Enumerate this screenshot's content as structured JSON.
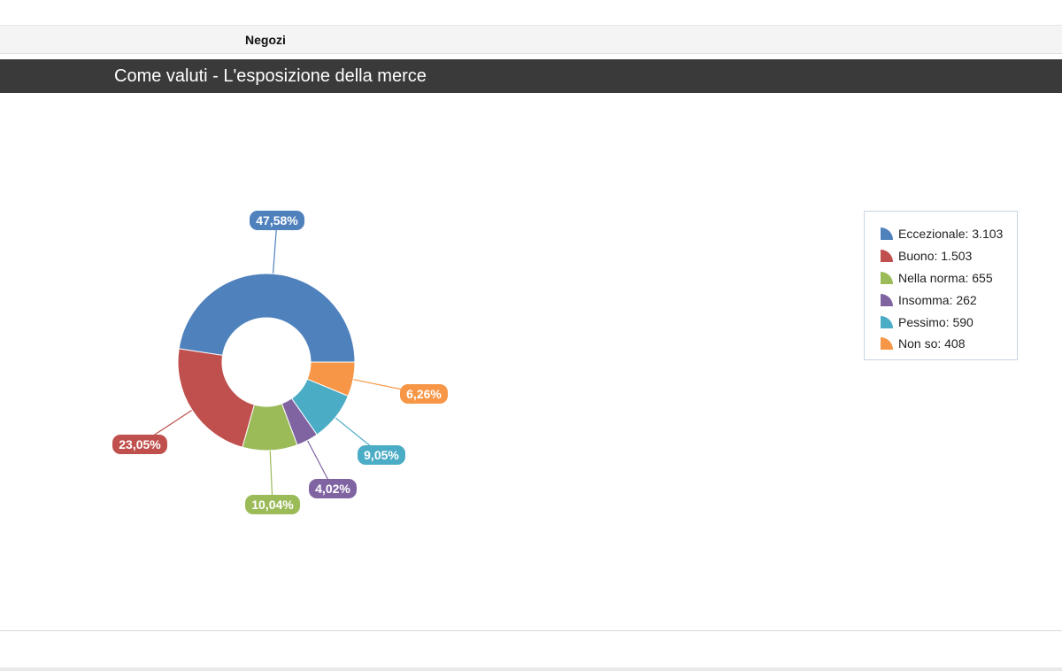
{
  "tab": {
    "label": "Negozi"
  },
  "title": "Come valuti - L'esposizione della merce",
  "chart_data": {
    "type": "pie",
    "variant": "donut",
    "legend_placement": "right",
    "slices": [
      {
        "name": "Eccezionale",
        "value": 3103,
        "value_label": "3.103",
        "percent_label": "47,58%",
        "color": "#4f81bd"
      },
      {
        "name": "Buono",
        "value": 1503,
        "value_label": "1.503",
        "percent_label": "23,05%",
        "color": "#c0504d"
      },
      {
        "name": "Nella norma",
        "value": 655,
        "value_label": "655",
        "percent_label": "10,04%",
        "color": "#9bbb59"
      },
      {
        "name": "Insomma",
        "value": 262,
        "value_label": "262",
        "percent_label": "4,02%",
        "color": "#8064a2"
      },
      {
        "name": "Pessimo",
        "value": 590,
        "value_label": "590",
        "percent_label": "9,05%",
        "color": "#4bacc6"
      },
      {
        "name": "Non so",
        "value": 408,
        "value_label": "408",
        "percent_label": "6,26%",
        "color": "#f79646"
      }
    ]
  }
}
